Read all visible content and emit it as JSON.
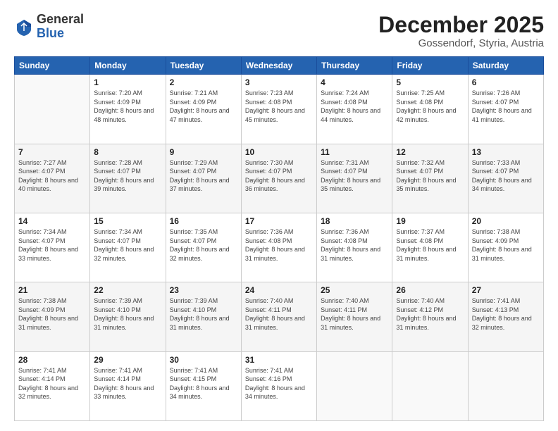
{
  "header": {
    "logo_general": "General",
    "logo_blue": "Blue",
    "month": "December 2025",
    "location": "Gossendorf, Styria, Austria"
  },
  "weekdays": [
    "Sunday",
    "Monday",
    "Tuesday",
    "Wednesday",
    "Thursday",
    "Friday",
    "Saturday"
  ],
  "weeks": [
    [
      {
        "day": "",
        "empty": true
      },
      {
        "day": "1",
        "sunrise": "7:20 AM",
        "sunset": "4:09 PM",
        "daylight": "8 hours and 48 minutes."
      },
      {
        "day": "2",
        "sunrise": "7:21 AM",
        "sunset": "4:09 PM",
        "daylight": "8 hours and 47 minutes."
      },
      {
        "day": "3",
        "sunrise": "7:23 AM",
        "sunset": "4:08 PM",
        "daylight": "8 hours and 45 minutes."
      },
      {
        "day": "4",
        "sunrise": "7:24 AM",
        "sunset": "4:08 PM",
        "daylight": "8 hours and 44 minutes."
      },
      {
        "day": "5",
        "sunrise": "7:25 AM",
        "sunset": "4:08 PM",
        "daylight": "8 hours and 42 minutes."
      },
      {
        "day": "6",
        "sunrise": "7:26 AM",
        "sunset": "4:07 PM",
        "daylight": "8 hours and 41 minutes."
      }
    ],
    [
      {
        "day": "7",
        "sunrise": "7:27 AM",
        "sunset": "4:07 PM",
        "daylight": "8 hours and 40 minutes."
      },
      {
        "day": "8",
        "sunrise": "7:28 AM",
        "sunset": "4:07 PM",
        "daylight": "8 hours and 39 minutes."
      },
      {
        "day": "9",
        "sunrise": "7:29 AM",
        "sunset": "4:07 PM",
        "daylight": "8 hours and 37 minutes."
      },
      {
        "day": "10",
        "sunrise": "7:30 AM",
        "sunset": "4:07 PM",
        "daylight": "8 hours and 36 minutes."
      },
      {
        "day": "11",
        "sunrise": "7:31 AM",
        "sunset": "4:07 PM",
        "daylight": "8 hours and 35 minutes."
      },
      {
        "day": "12",
        "sunrise": "7:32 AM",
        "sunset": "4:07 PM",
        "daylight": "8 hours and 35 minutes."
      },
      {
        "day": "13",
        "sunrise": "7:33 AM",
        "sunset": "4:07 PM",
        "daylight": "8 hours and 34 minutes."
      }
    ],
    [
      {
        "day": "14",
        "sunrise": "7:34 AM",
        "sunset": "4:07 PM",
        "daylight": "8 hours and 33 minutes."
      },
      {
        "day": "15",
        "sunrise": "7:34 AM",
        "sunset": "4:07 PM",
        "daylight": "8 hours and 32 minutes."
      },
      {
        "day": "16",
        "sunrise": "7:35 AM",
        "sunset": "4:07 PM",
        "daylight": "8 hours and 32 minutes."
      },
      {
        "day": "17",
        "sunrise": "7:36 AM",
        "sunset": "4:08 PM",
        "daylight": "8 hours and 31 minutes."
      },
      {
        "day": "18",
        "sunrise": "7:36 AM",
        "sunset": "4:08 PM",
        "daylight": "8 hours and 31 minutes."
      },
      {
        "day": "19",
        "sunrise": "7:37 AM",
        "sunset": "4:08 PM",
        "daylight": "8 hours and 31 minutes."
      },
      {
        "day": "20",
        "sunrise": "7:38 AM",
        "sunset": "4:09 PM",
        "daylight": "8 hours and 31 minutes."
      }
    ],
    [
      {
        "day": "21",
        "sunrise": "7:38 AM",
        "sunset": "4:09 PM",
        "daylight": "8 hours and 31 minutes."
      },
      {
        "day": "22",
        "sunrise": "7:39 AM",
        "sunset": "4:10 PM",
        "daylight": "8 hours and 31 minutes."
      },
      {
        "day": "23",
        "sunrise": "7:39 AM",
        "sunset": "4:10 PM",
        "daylight": "8 hours and 31 minutes."
      },
      {
        "day": "24",
        "sunrise": "7:40 AM",
        "sunset": "4:11 PM",
        "daylight": "8 hours and 31 minutes."
      },
      {
        "day": "25",
        "sunrise": "7:40 AM",
        "sunset": "4:11 PM",
        "daylight": "8 hours and 31 minutes."
      },
      {
        "day": "26",
        "sunrise": "7:40 AM",
        "sunset": "4:12 PM",
        "daylight": "8 hours and 31 minutes."
      },
      {
        "day": "27",
        "sunrise": "7:41 AM",
        "sunset": "4:13 PM",
        "daylight": "8 hours and 32 minutes."
      }
    ],
    [
      {
        "day": "28",
        "sunrise": "7:41 AM",
        "sunset": "4:14 PM",
        "daylight": "8 hours and 32 minutes."
      },
      {
        "day": "29",
        "sunrise": "7:41 AM",
        "sunset": "4:14 PM",
        "daylight": "8 hours and 33 minutes."
      },
      {
        "day": "30",
        "sunrise": "7:41 AM",
        "sunset": "4:15 PM",
        "daylight": "8 hours and 34 minutes."
      },
      {
        "day": "31",
        "sunrise": "7:41 AM",
        "sunset": "4:16 PM",
        "daylight": "8 hours and 34 minutes."
      },
      {
        "day": "",
        "empty": true
      },
      {
        "day": "",
        "empty": true
      },
      {
        "day": "",
        "empty": true
      }
    ]
  ]
}
